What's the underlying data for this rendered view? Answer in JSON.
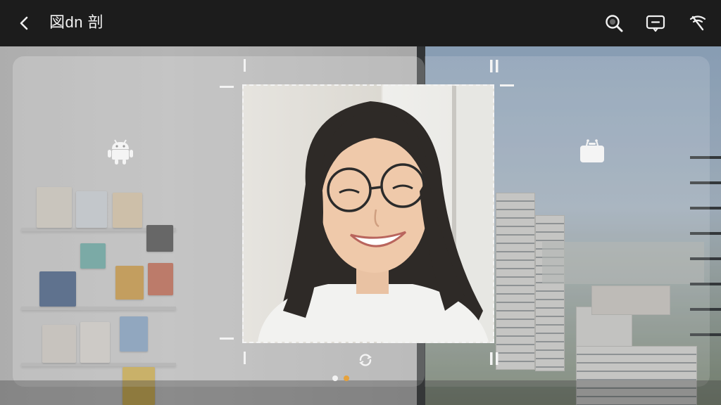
{
  "app": {
    "title": "図dn 剖"
  },
  "toolbar": {
    "back_icon": "chevron-left-icon",
    "right_icons": [
      "search-icon",
      "chat-bubble-icon",
      "no-signal-icon"
    ]
  },
  "overlay": {
    "left_icon": "android-icon",
    "right_icon": "shopping-bag-icon",
    "rotate_icon": "rotate-icon",
    "pause_icon": "pause-icon"
  },
  "pagination": {
    "count": 2,
    "active_index": 1
  },
  "colors": {
    "topbar": "#1c1c1c",
    "accent_dot": "#e6a23c",
    "inactive_dot": "#f2f2f2"
  }
}
